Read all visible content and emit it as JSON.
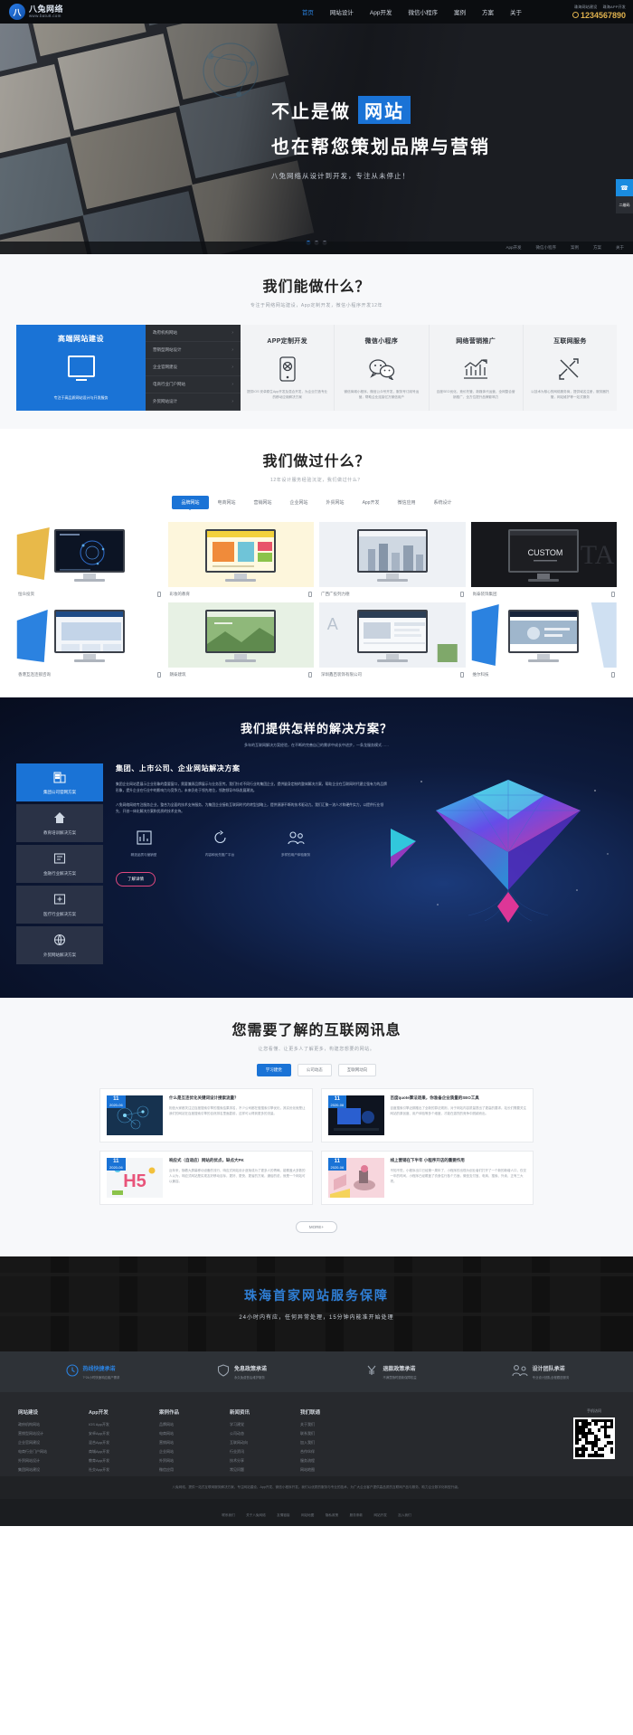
{
  "header": {
    "logo_name": "八兔网络",
    "logo_url": "www.batu8.com",
    "mini_left": "珠海网站建设",
    "mini_right": "珠海APP开发",
    "phone": "1234567890",
    "nav": [
      {
        "label": "首页",
        "active": true
      },
      {
        "label": "网站设计",
        "active": false
      },
      {
        "label": "App开发",
        "active": false
      },
      {
        "label": "微信小程序",
        "active": false
      },
      {
        "label": "案例",
        "active": false
      },
      {
        "label": "方案",
        "active": false
      },
      {
        "label": "关于",
        "active": false
      }
    ]
  },
  "hero": {
    "line1_prefix": "不止是做",
    "line1_highlight": "网站",
    "line2": "也在帮您策划品牌与营销",
    "subtitle": "八兔网络从设计到开发，专注从未停止！",
    "side_buttons": [
      "客服",
      "二维码"
    ],
    "strip": [
      "App开发",
      "微信小程序",
      "案例",
      "方案",
      "关于"
    ]
  },
  "services": {
    "title": "我们能做什么？",
    "subtitle": "专注于网络网站建设，App定制开发，微信小程序开发12年",
    "feature": {
      "title": "高端网站建设",
      "desc": "专注于高品质网站设计与开发服务"
    },
    "list": [
      {
        "label": "政府机构网站"
      },
      {
        "label": "营销型网站设计"
      },
      {
        "label": "企业官网建设"
      },
      {
        "label": "电商行业门户网站"
      },
      {
        "label": "外贸网站设计"
      }
    ],
    "cards": [
      {
        "title": "APP定制开发",
        "icon": "mobile-icon",
        "desc": "提供IOS 安卓原生App开发及混合开发，为企业打造专业的移动应用解决方案"
      },
      {
        "title": "微信小程序",
        "icon": "wechat-icon",
        "desc": "微信商城小程序，微信公众号开发，服务号订阅号运营，帮助企业连接亿万微信用户"
      },
      {
        "title": "网络营销推广",
        "icon": "chart-icon",
        "desc": "百度SEO优化，竞价托管，新媒体代运营，全网整合营销推广，全方位提升品牌影响力"
      },
      {
        "title": "互联网服务",
        "icon": "tools-icon",
        "desc": "以技术为核心的网络服务商，提供域名注册，服务器托管，网站维护等一站式服务"
      }
    ]
  },
  "portfolio": {
    "title": "我们做过什么？",
    "subtitle": "12年设计服务经验沉淀，我们做过什么？",
    "tabs": [
      {
        "label": "品牌网站",
        "active": true
      },
      {
        "label": "电商网站",
        "active": false
      },
      {
        "label": "营销网站",
        "active": false
      },
      {
        "label": "企业网站",
        "active": false
      },
      {
        "label": "外贸网站",
        "active": false
      },
      {
        "label": "App开发",
        "active": false
      },
      {
        "label": "微信应用",
        "active": false
      },
      {
        "label": "系统设计",
        "active": false
      }
    ],
    "cases": [
      {
        "name": "恒众投资",
        "accent": "#e8b949",
        "bg": "#ffffff",
        "shot": "dark-tech"
      },
      {
        "name": "彩妆的教育",
        "accent": "#f2d13c",
        "bg": "#fdf6dc",
        "shot": "yellow-edu"
      },
      {
        "name": "广西广投列力德",
        "accent": "#d9dde2",
        "bg": "#eef1f5",
        "shot": "city-gray"
      },
      {
        "name": "尚泰装饰集团",
        "accent": "#1a1a1a",
        "bg": "#17181c",
        "shot": "custom-black"
      },
      {
        "name": "香港互连连锁咨询",
        "accent": "#2b82e0",
        "bg": "#ffffff",
        "shot": "blue-corp"
      },
      {
        "name": "朗泰建筑",
        "accent": "#4a8c4a",
        "bg": "#e7f1e4",
        "shot": "green-build"
      },
      {
        "name": "深圳鑫百装饰有限公司",
        "accent": "#bcc6d2",
        "bg": "#eef1f5",
        "shot": "office-gray"
      },
      {
        "name": "维尔科技",
        "accent": "#2b82e0",
        "bg": "#ffffff",
        "shot": "blue-tech"
      }
    ]
  },
  "solutions": {
    "title": "我们提供怎样的解决方案？",
    "subtitle": "多年的互联网解决方案经验，在不断的完善自己的需求中成长中进步，一条龙服务模式……",
    "menu": [
      {
        "label": "集团公司官网方案",
        "icon": "building-icon",
        "active": true
      },
      {
        "label": "教育培训解决方案",
        "icon": "home-icon",
        "active": false
      },
      {
        "label": "金融行业解决方案",
        "icon": "finance-icon",
        "active": false
      },
      {
        "label": "医疗行业解决方案",
        "icon": "medical-icon",
        "active": false
      },
      {
        "label": "外贸网站解决方案",
        "icon": "trade-icon",
        "active": false
      }
    ],
    "content_title": "集团、上市公司、企业网站解决方案",
    "paragraph1": "集团企业网站是展示企业形象的重要窗口，需要兼顾品牌展示与业务宣传。我们针对不同行业的集团企业，提供量身定制的整体解决方案，帮助企业在互联网时代建立强有力的品牌形象，提升企业在行业中的影响力与竞争力。未来仍处于领先地位，领跑领导市场发展潮流。",
    "paragraph2": "八兔网络网络专注服务企业，整合为全面的技术支持服务，为集团企业接轨互联网时代的转型战略上，提供源源不断的技术驱动力。我们汇聚一流人才和硬件实力，以提供行业领先、开创一体化解决方案和优质的技术支持。",
    "features": [
      {
        "label": "精选品质与营销型",
        "icon": "chart-bar-icon"
      },
      {
        "label": "内容和优先推广平台",
        "icon": "refresh-icon"
      },
      {
        "label": "多样的用户体验服务",
        "icon": "users-icon"
      }
    ],
    "button": "了解详情"
  },
  "news": {
    "title": "您需要了解的互联网讯息",
    "subtitle": "让您看懂、让更多人了解更多，构建您想要的网站。",
    "tabs": [
      {
        "label": "学习建党",
        "active": true
      },
      {
        "label": "公司动态",
        "active": false
      },
      {
        "label": "互联网动向",
        "active": false
      }
    ],
    "items": [
      {
        "day": "11",
        "month": "2020-06",
        "title": "什么是互连优化关键词设计搜索流量？",
        "desc": "相信大家都关注过百度搜索引擎的搜索结果排名，不少公司都在做搜索引擎优化，其实优化就是让我们的网站在百度搜索引擎的自然排名里面靠前，这样可以得到更多的流量。",
        "thumb": "network-blue"
      },
      {
        "day": "11",
        "month": "2020-06",
        "title": "百度quote算法退果，你准备企业质量的SEO工具",
        "desc": "百度搜索引擎近期推出了全新的算法规则，对于网站内容质量提出了更高的要求。站长们需要关注网站的原创度、用户体验等多个维度，才能在激烈的竞争中脱颖而出。",
        "thumb": "speaker-dark"
      },
      {
        "day": "11",
        "month": "2020-06",
        "title": "响应式（自适应）网站的优点，缺点大PK",
        "desc": "近年来，随着大屏幕移动设备的流行，响应式网站设计逐渐成为了更多人的青睐。能覆盖大多数的人以为，响应式网站是实现友好移动目标，更好、更快、更省的方案，通俗的说，就是一个网站可以兼容。",
        "thumb": "h5-color"
      },
      {
        "day": "11",
        "month": "2020-06",
        "title": "线上营销在下半年 小程序开店的重要作用",
        "desc": "不知不觉，小程序出口已经第一周年了，小程序的出现为创业者们打开了一个新的新增人口，仅仅一年的时间，小程序已经覆盖了衣食住行各个方面，微信支付宝、电商、搜索、外卖、正有三大项。",
        "thumb": "pink-3d"
      }
    ],
    "more": "MORE+"
  },
  "banner": {
    "title": "珠海首家网站服务保障",
    "subtitle": "24小时内有应，任何异常处理，15分钟内能准开始处理"
  },
  "promise": [
    {
      "title": "热线快捷承诺",
      "sub": "7*24小时快速响应客户需求",
      "icon": "clock-icon",
      "highlight": true
    },
    {
      "title": "免息政策承诺",
      "sub": "永久免费售后维护服务",
      "icon": "shield-icon",
      "highlight": false
    },
    {
      "title": "退款政策承诺",
      "sub": "不满意随时退款保障权益",
      "icon": "money-icon",
      "highlight": false
    },
    {
      "title": "设计团队承诺",
      "sub": "专业设计团队全程跟进服务",
      "icon": "team-icon",
      "highlight": false
    }
  ],
  "footer": {
    "columns": [
      {
        "title": "网站建设",
        "links": [
          "政府机构网站",
          "营销型网站设计",
          "企业官网建设",
          "电商行业门户网站",
          "外贸网站设计",
          "集团网站建设"
        ]
      },
      {
        "title": "App开发",
        "links": [
          "IOS App开发",
          "安卓App开发",
          "混合App开发",
          "商城App开发",
          "教育App开发",
          "社交App开发"
        ]
      },
      {
        "title": "案例作品",
        "links": [
          "品牌网站",
          "电商网站",
          "营销网站",
          "企业网站",
          "外贸网站",
          "微信应用"
        ]
      },
      {
        "title": "新闻资讯",
        "links": [
          "学习建党",
          "公司动态",
          "互联网动向",
          "行业资讯",
          "技术分享",
          "常见问题"
        ]
      },
      {
        "title": "我们联通",
        "links": [
          "关于我们",
          "联系我们",
          "加入我们",
          "合作伙伴",
          "服务流程",
          "网站地图"
        ]
      }
    ],
    "qr_label": "手机访问",
    "copyright": "八兔网络，提供一站式互联网服务解决方案，专注网站建设、App开发、微信小程序开发。我们以优质的服务与专业的技术，为广大企业客户提供高品质的互联网产品与服务，助力企业数字化转型升级。",
    "bottom_links": [
      "联系我们",
      "关于八兔网络",
      "友情链接",
      "网站地图",
      "隐私政策",
      "服务条款",
      "网站开发",
      "加入我们"
    ]
  }
}
